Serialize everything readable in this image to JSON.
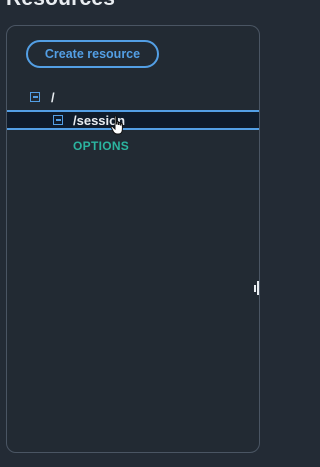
{
  "heading": "Resources",
  "actions": {
    "create_resource_label": "Create resource"
  },
  "tree": {
    "root": {
      "path": "/",
      "expanded": true
    },
    "session": {
      "path": "/session",
      "expanded": true,
      "selected": true,
      "methods": [
        "OPTIONS"
      ]
    }
  },
  "colors": {
    "accent": "#539fe5",
    "method": "#2bb5a0",
    "background": "#232b35",
    "selected_background": "#0f1b2a"
  },
  "icons": {
    "tree_toggle": "collapse-square-icon",
    "pointer": "hand-pointer-icon",
    "resize": "resize-handle-icon"
  }
}
